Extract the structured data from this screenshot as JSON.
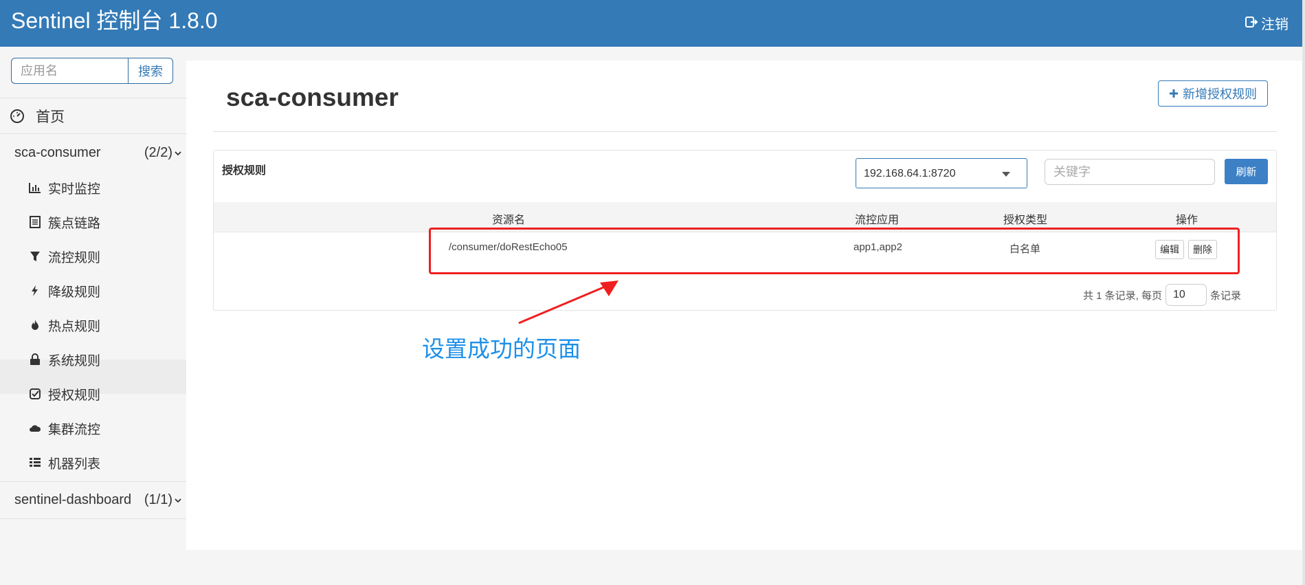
{
  "header": {
    "brand": "Sentinel 控制台 1.8.0",
    "logout_label": "注销",
    "brand_color": "#337ab7"
  },
  "sidebar": {
    "search_placeholder": "应用名",
    "search_button": "搜索",
    "home_label": "首页",
    "apps": [
      {
        "name": "sca-consumer",
        "count": "(2/2)",
        "items": [
          {
            "label": "实时监控",
            "icon": "bar-chart-icon"
          },
          {
            "label": "簇点链路",
            "icon": "list-alt-icon"
          },
          {
            "label": "流控规则",
            "icon": "filter-icon"
          },
          {
            "label": "降级规则",
            "icon": "flash-icon"
          },
          {
            "label": "热点规则",
            "icon": "fire-icon"
          },
          {
            "label": "系统规则",
            "icon": "lock-icon"
          },
          {
            "label": "授权规则",
            "icon": "check-icon"
          },
          {
            "label": "集群流控",
            "icon": "cloud-icon"
          },
          {
            "label": "机器列表",
            "icon": "th-list-icon"
          }
        ]
      },
      {
        "name": "sentinel-dashboard",
        "count": "(1/1)"
      }
    ]
  },
  "main": {
    "title": "sca-consumer",
    "add_button": "新增授权规则",
    "panel_title": "授权规则",
    "machine_selected": "192.168.64.1:8720",
    "keyword_placeholder": "关键字",
    "refresh_button": "刷新",
    "columns": [
      "资源名",
      "流控应用",
      "授权类型",
      "操作"
    ],
    "rows": [
      {
        "resource": "/consumer/doRestEcho05",
        "limit_app": "app1,app2",
        "strategy": "白名单",
        "edit": "编辑",
        "delete": "删除"
      }
    ],
    "pager": {
      "prefix": "共 1 条记录, 每页",
      "page_size": "10",
      "suffix": "条记录"
    }
  },
  "annotation": {
    "text": "设置成功的页面",
    "color": "#1e90e8",
    "box_color": "#ef1f1f"
  }
}
